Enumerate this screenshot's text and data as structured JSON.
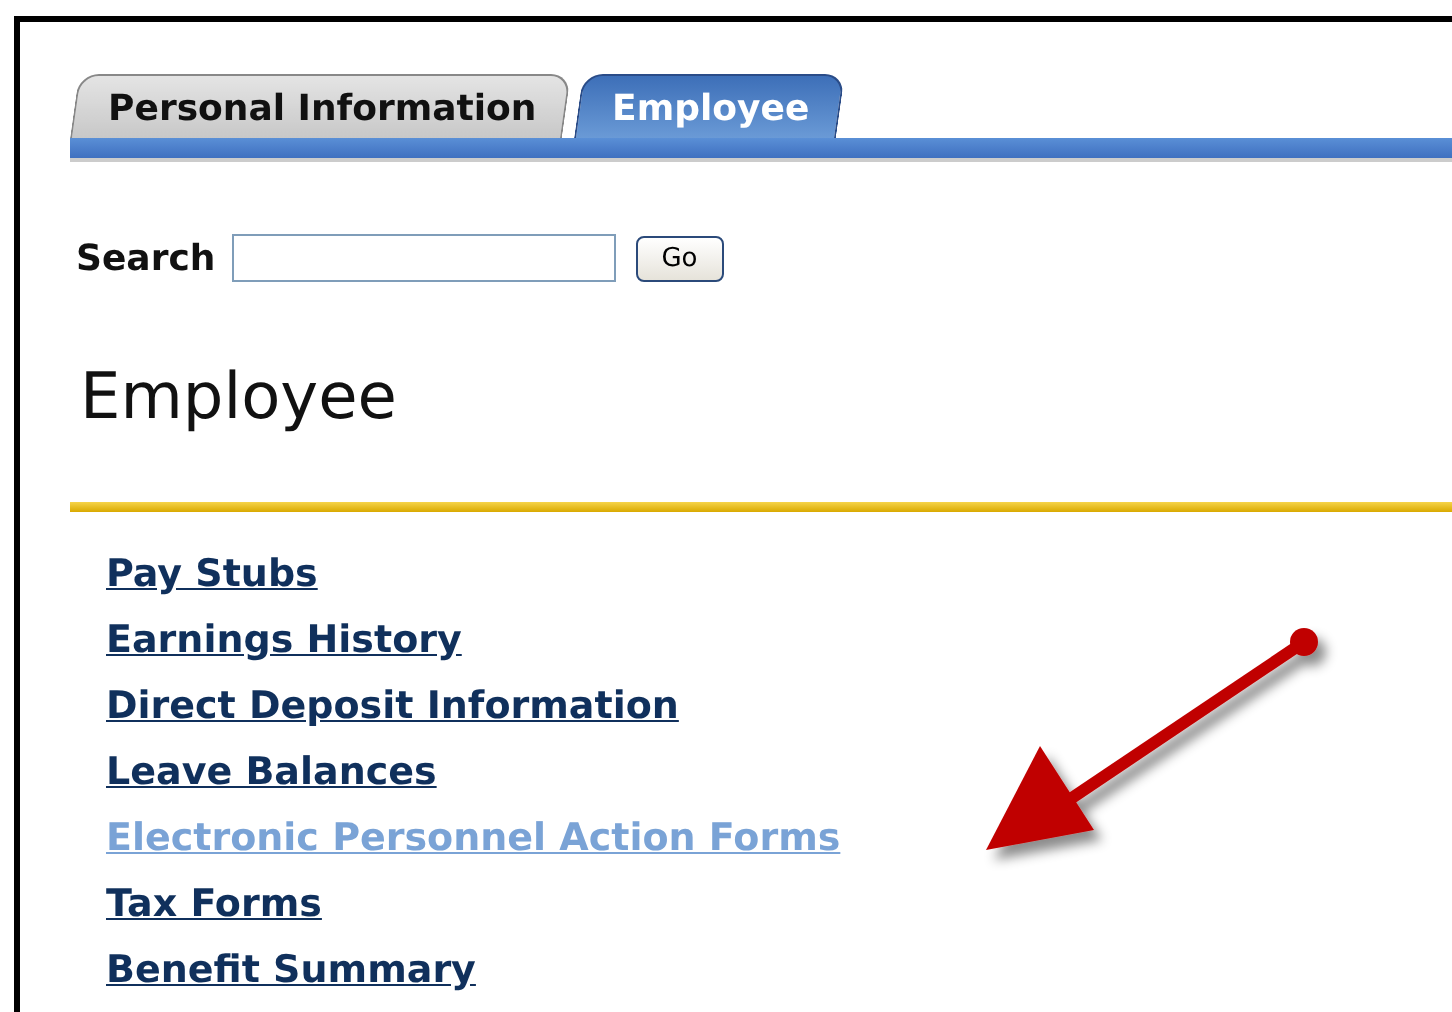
{
  "tabs": [
    {
      "label": "Personal Information",
      "selected": false
    },
    {
      "label": "Employee",
      "selected": true
    }
  ],
  "search": {
    "label": "Search",
    "button": "Go"
  },
  "heading": "Employee",
  "links": [
    {
      "label": "Pay Stubs",
      "highlighted": false
    },
    {
      "label": "Earnings History",
      "highlighted": false
    },
    {
      "label": "Direct Deposit Information",
      "highlighted": false
    },
    {
      "label": "Leave Balances",
      "highlighted": false
    },
    {
      "label": "Electronic Personnel Action Forms",
      "highlighted": true
    },
    {
      "label": "Tax Forms",
      "highlighted": false
    },
    {
      "label": "Benefit Summary",
      "highlighted": false
    }
  ]
}
